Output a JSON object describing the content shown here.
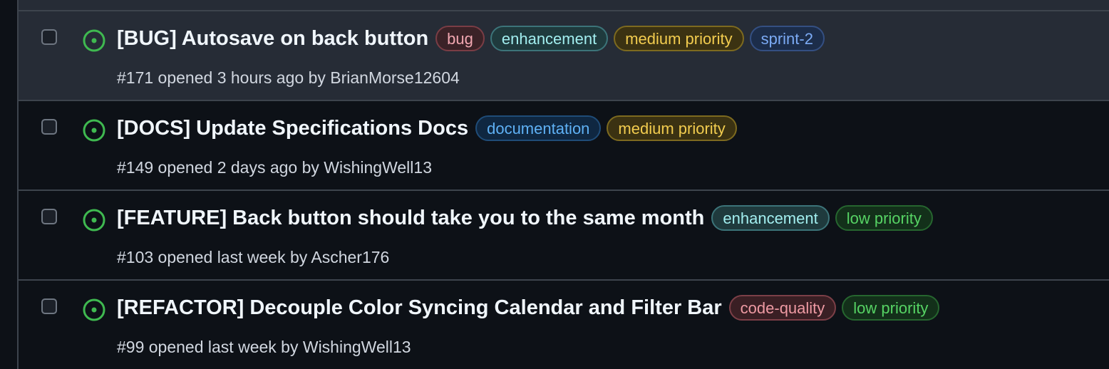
{
  "issues": [
    {
      "title": "[BUG] Autosave on back button",
      "meta_prefix": "#171 opened 3 hours ago by ",
      "author": "BrianMorse12604",
      "labels": [
        {
          "text": "bug",
          "bg": "#3b2227",
          "border": "#7a3d45",
          "color": "#f2a7b1"
        },
        {
          "text": "enhancement",
          "bg": "#1f3a3d",
          "border": "#3c7479",
          "color": "#a2eeef"
        },
        {
          "text": "medium priority",
          "bg": "#3b3212",
          "border": "#7d6a1f",
          "color": "#f2cc4f"
        },
        {
          "text": "sprint-2",
          "bg": "#1c2d4a",
          "border": "#344f82",
          "color": "#7cabf5"
        }
      ]
    },
    {
      "title": "[DOCS] Update Specifications Docs",
      "meta_prefix": "#149 opened 2 days ago by ",
      "author": "WishingWell13",
      "labels": [
        {
          "text": "documentation",
          "bg": "#0f2741",
          "border": "#1f4c78",
          "color": "#5fb1f5"
        },
        {
          "text": "medium priority",
          "bg": "#3b3212",
          "border": "#7d6a1f",
          "color": "#f2cc4f"
        }
      ]
    },
    {
      "title": "[FEATURE] Back button should take you to the same month",
      "meta_prefix": "#103 opened last week by ",
      "author": "Ascher176",
      "labels": [
        {
          "text": "enhancement",
          "bg": "#1f3a3d",
          "border": "#3c7479",
          "color": "#a2eeef"
        },
        {
          "text": "low priority",
          "bg": "#13301a",
          "border": "#26662f",
          "color": "#56d364"
        }
      ]
    },
    {
      "title": "[REFACTOR] Decouple Color Syncing Calendar and Filter Bar",
      "meta_prefix": "#99 opened last week by ",
      "author": "WishingWell13",
      "labels": [
        {
          "text": "code-quality",
          "bg": "#3a1f24",
          "border": "#7c3f47",
          "color": "#ee9aa3"
        },
        {
          "text": "low priority",
          "bg": "#13301a",
          "border": "#26662f",
          "color": "#56d364"
        }
      ]
    }
  ],
  "colors": {
    "open_icon": "#3fb950",
    "background": "#0d1117",
    "hover_row": "#262c36",
    "divider": "#3d444d"
  },
  "icons": {
    "status": "issue-opened-icon"
  }
}
